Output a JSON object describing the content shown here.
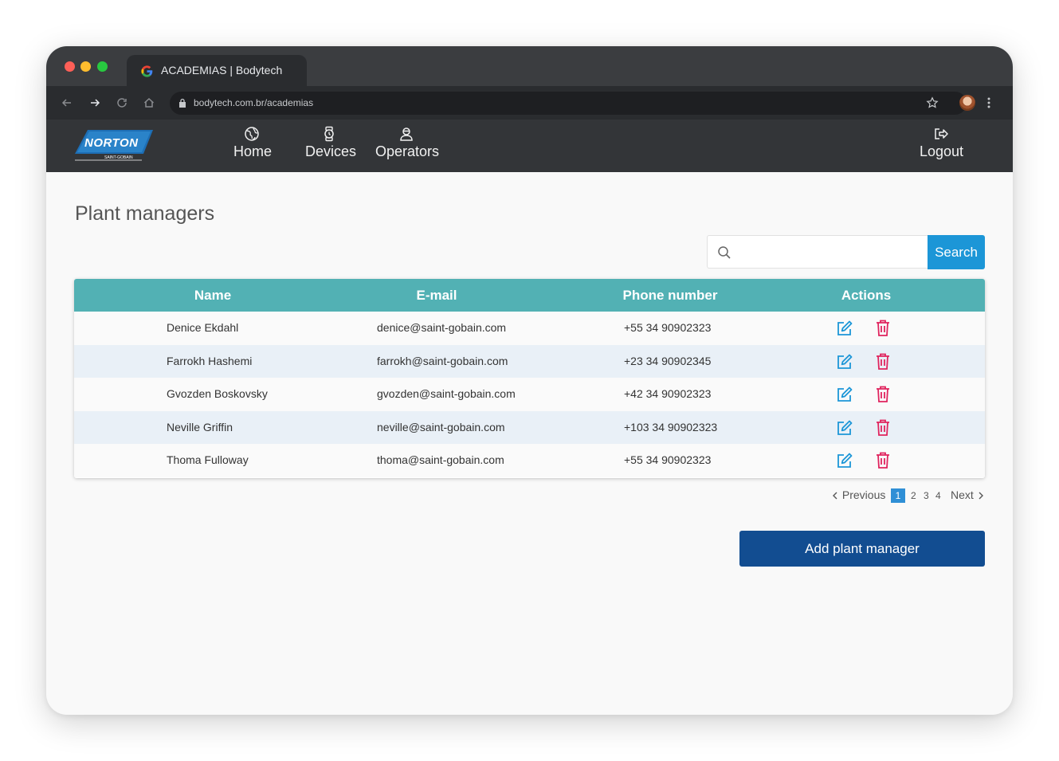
{
  "browser": {
    "tab_title": "ACADEMIAS | Bodytech",
    "url": "bodytech.com.br/academias"
  },
  "app": {
    "logo_text": "NORTON",
    "logo_subtext": "SAINT-GOBAIN",
    "nav": {
      "home": "Home",
      "devices": "Devices",
      "operators": "Operators",
      "logout": "Logout"
    }
  },
  "page": {
    "title": "Plant managers",
    "search": {
      "placeholder": "",
      "value": "",
      "button_label": "Search"
    },
    "table": {
      "headers": {
        "name": "Name",
        "email": "E-mail",
        "phone": "Phone number",
        "actions": "Actions"
      },
      "rows": [
        {
          "name": "Denice Ekdahl",
          "email": "denice@saint-gobain.com",
          "phone": "+55 34 90902323"
        },
        {
          "name": "Farrokh Hashemi",
          "email": "farrokh@saint-gobain.com",
          "phone": "+23 34 90902345"
        },
        {
          "name": "Gvozden Boskovsky",
          "email": "gvozden@saint-gobain.com",
          "phone": "+42 34 90902323"
        },
        {
          "name": "Neville Griffin",
          "email": "neville@saint-gobain.com",
          "phone": "+103 34 90902323"
        },
        {
          "name": "Thoma Fulloway",
          "email": "thoma@saint-gobain.com",
          "phone": "+55 34 90902323"
        }
      ]
    },
    "pagination": {
      "previous": "Previous",
      "pages": [
        "1",
        "2",
        "3",
        "4"
      ],
      "current": "1",
      "next": "Next"
    },
    "add_button": "Add plant manager"
  },
  "colors": {
    "table_header": "#52b1b4",
    "search_button": "#1c96d7",
    "add_button": "#124d91",
    "edit_icon": "#1c96d7",
    "delete_icon": "#e0245e",
    "active_page": "#2f8fd6"
  }
}
